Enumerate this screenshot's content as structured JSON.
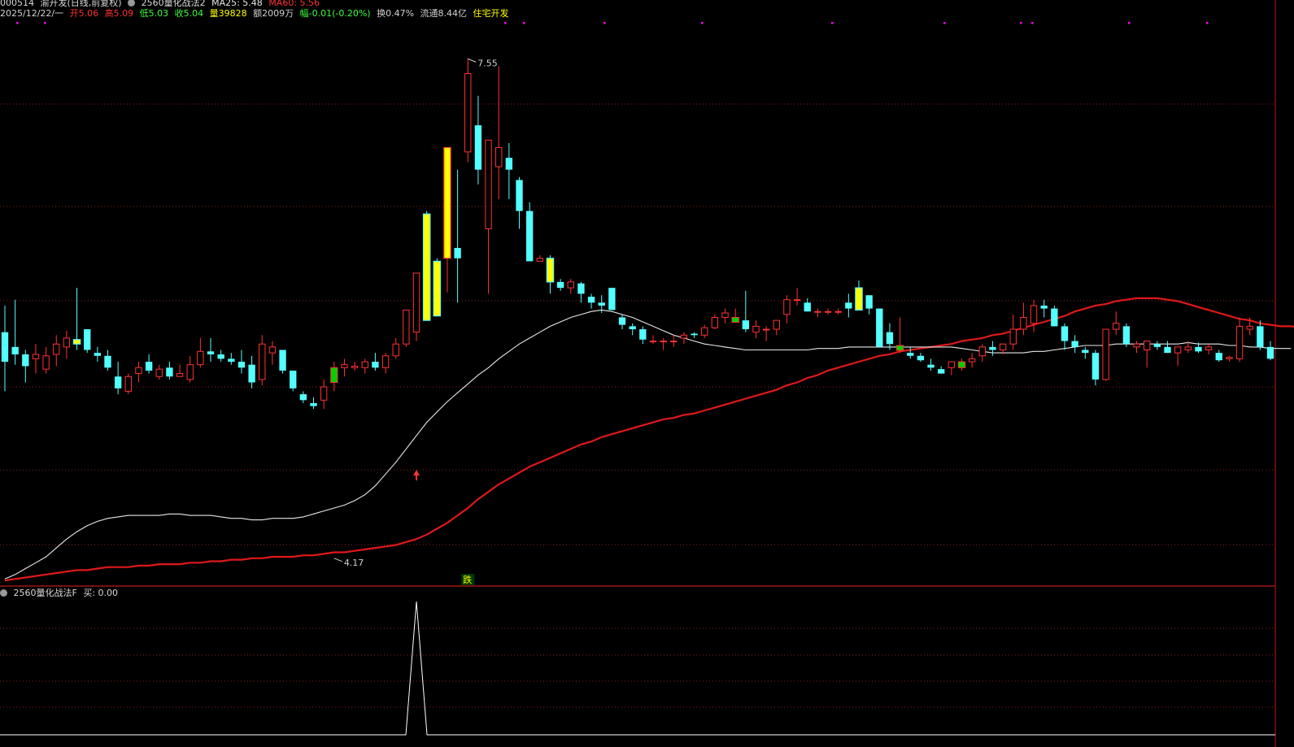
{
  "header": {
    "code": "000514",
    "name": "渝开发(日线,前复权)",
    "indicator": "2560量化战法2",
    "ma25": "MA25: 5.48",
    "ma60": "MA60: 5.56",
    "date": "2025/12/22/一",
    "open": "开5.06",
    "high": "高5.09",
    "low": "低5.03",
    "close": "收5.04",
    "volume": "量39828",
    "amount": "额2009万",
    "change": "幅-0.01(-0.20%)",
    "turnover": "换0.47%",
    "float_cap": "流通8.44亿",
    "sector": "住宅开发"
  },
  "sub": {
    "indicator": "2560量化战法F",
    "buy": "买: 0.00"
  },
  "colors": {
    "up": "#ff3232",
    "down": "#54ffff",
    "ma25": "#e8e8e8",
    "ma60": "#e01818",
    "grid": "#8a1e1e",
    "signal": "#ffff00",
    "marker": "#ff00ff",
    "green_box": "#00d000"
  },
  "chart_data": [
    {
      "type": "candlestick",
      "title": "",
      "y_annotations": [
        {
          "label": "7.55",
          "value": 7.55,
          "kind": "high"
        },
        {
          "label": "4.17",
          "value": 4.17,
          "kind": "low"
        }
      ],
      "signal_label": "跌",
      "ylim": [
        4.07,
        7.75
      ],
      "candles": [
        [
          5.7,
          5.88,
          5.3,
          5.5
        ],
        [
          5.6,
          5.92,
          5.48,
          5.55
        ],
        [
          5.55,
          5.58,
          5.36,
          5.47
        ],
        [
          5.52,
          5.62,
          5.42,
          5.55
        ],
        [
          5.45,
          5.6,
          5.42,
          5.54
        ],
        [
          5.55,
          5.68,
          5.47,
          5.62
        ],
        [
          5.6,
          5.71,
          5.52,
          5.66
        ],
        [
          5.65,
          6.0,
          5.58,
          5.62
        ],
        [
          5.72,
          5.72,
          5.56,
          5.58
        ],
        [
          5.56,
          5.6,
          5.5,
          5.54
        ],
        [
          5.54,
          5.58,
          5.44,
          5.46
        ],
        [
          5.4,
          5.5,
          5.28,
          5.32
        ],
        [
          5.3,
          5.42,
          5.28,
          5.4
        ],
        [
          5.42,
          5.5,
          5.36,
          5.46
        ],
        [
          5.5,
          5.55,
          5.42,
          5.44
        ],
        [
          5.4,
          5.48,
          5.38,
          5.45
        ],
        [
          5.46,
          5.5,
          5.38,
          5.4
        ],
        [
          5.4,
          5.48,
          5.4,
          5.42
        ],
        [
          5.38,
          5.54,
          5.36,
          5.48
        ],
        [
          5.48,
          5.66,
          5.46,
          5.57
        ],
        [
          5.57,
          5.66,
          5.5,
          5.55
        ],
        [
          5.55,
          5.58,
          5.5,
          5.52
        ],
        [
          5.52,
          5.56,
          5.48,
          5.5
        ],
        [
          5.5,
          5.58,
          5.42,
          5.46
        ],
        [
          5.48,
          5.54,
          5.32,
          5.36
        ],
        [
          5.38,
          5.68,
          5.34,
          5.62
        ],
        [
          5.56,
          5.64,
          5.48,
          5.6
        ],
        [
          5.58,
          5.58,
          5.42,
          5.44
        ],
        [
          5.44,
          5.44,
          5.3,
          5.32
        ],
        [
          5.28,
          5.3,
          5.22,
          5.24
        ],
        [
          5.22,
          5.26,
          5.18,
          5.2
        ],
        [
          5.24,
          5.38,
          5.18,
          5.33
        ],
        [
          5.36,
          5.5,
          5.3,
          5.46
        ],
        [
          5.46,
          5.52,
          5.4,
          5.48
        ],
        [
          5.46,
          5.5,
          5.44,
          5.47
        ],
        [
          5.46,
          5.52,
          5.42,
          5.5
        ],
        [
          5.5,
          5.56,
          5.44,
          5.46
        ],
        [
          5.46,
          5.56,
          5.42,
          5.54
        ],
        [
          5.54,
          5.66,
          5.52,
          5.62
        ],
        [
          5.62,
          5.85,
          5.6,
          5.85
        ],
        [
          5.7,
          6.1,
          5.64,
          6.1
        ],
        [
          6.5,
          6.52,
          5.78,
          5.78
        ],
        [
          6.18,
          6.2,
          5.81,
          5.81
        ],
        [
          6.2,
          6.95,
          5.97,
          6.95
        ],
        [
          6.27,
          6.8,
          5.9,
          6.2
        ],
        [
          6.92,
          7.55,
          6.85,
          7.45
        ],
        [
          7.1,
          7.3,
          6.7,
          6.8
        ],
        [
          6.4,
          7.0,
          5.96,
          7.0
        ],
        [
          6.82,
          7.5,
          6.6,
          6.95
        ],
        [
          6.88,
          6.98,
          6.6,
          6.8
        ],
        [
          6.73,
          6.75,
          6.4,
          6.52
        ],
        [
          6.52,
          6.58,
          6.18,
          6.18
        ],
        [
          6.18,
          6.22,
          6.18,
          6.2
        ],
        [
          6.2,
          6.22,
          5.96,
          6.04
        ],
        [
          6.04,
          6.06,
          5.98,
          6.0
        ],
        [
          6.0,
          6.06,
          5.96,
          6.04
        ],
        [
          6.03,
          6.04,
          5.9,
          5.96
        ],
        [
          5.94,
          5.96,
          5.86,
          5.9
        ],
        [
          5.9,
          5.95,
          5.83,
          5.88
        ],
        [
          6.0,
          6.0,
          5.85,
          5.85
        ],
        [
          5.8,
          5.82,
          5.72,
          5.75
        ],
        [
          5.74,
          5.76,
          5.68,
          5.72
        ],
        [
          5.72,
          5.74,
          5.62,
          5.65
        ],
        [
          5.64,
          5.68,
          5.62,
          5.64
        ],
        [
          5.64,
          5.66,
          5.58,
          5.64
        ],
        [
          5.64,
          5.68,
          5.6,
          5.64
        ],
        [
          5.66,
          5.7,
          5.62,
          5.68
        ],
        [
          5.69,
          5.7,
          5.66,
          5.68
        ],
        [
          5.68,
          5.75,
          5.66,
          5.73
        ],
        [
          5.73,
          5.82,
          5.72,
          5.8
        ],
        [
          5.8,
          5.86,
          5.76,
          5.83
        ],
        [
          5.8,
          5.86,
          5.78,
          5.8
        ],
        [
          5.78,
          5.98,
          5.7,
          5.72
        ],
        [
          5.7,
          5.78,
          5.66,
          5.74
        ],
        [
          5.72,
          5.74,
          5.64,
          5.72
        ],
        [
          5.72,
          5.74,
          5.68,
          5.78
        ],
        [
          5.82,
          5.95,
          5.76,
          5.92
        ],
        [
          5.92,
          6.0,
          5.88,
          5.92
        ],
        [
          5.9,
          5.93,
          5.84,
          5.84
        ],
        [
          5.84,
          5.86,
          5.8,
          5.84
        ],
        [
          5.84,
          5.86,
          5.82,
          5.84
        ],
        [
          5.84,
          5.86,
          5.82,
          5.84
        ],
        [
          5.9,
          5.96,
          5.8,
          5.86
        ],
        [
          6.0,
          6.05,
          5.85,
          5.85
        ],
        [
          5.95,
          5.95,
          5.82,
          5.86
        ],
        [
          5.86,
          5.86,
          5.6,
          5.6
        ],
        [
          5.7,
          5.76,
          5.58,
          5.62
        ],
        [
          5.6,
          5.8,
          5.56,
          5.61
        ],
        [
          5.56,
          5.6,
          5.52,
          5.54
        ],
        [
          5.54,
          5.56,
          5.5,
          5.51
        ],
        [
          5.48,
          5.52,
          5.44,
          5.46
        ],
        [
          5.45,
          5.47,
          5.42,
          5.42
        ],
        [
          5.46,
          5.5,
          5.41,
          5.5
        ],
        [
          5.46,
          5.52,
          5.44,
          5.5
        ],
        [
          5.5,
          5.56,
          5.46,
          5.52
        ],
        [
          5.54,
          5.62,
          5.5,
          5.6
        ],
        [
          5.6,
          5.64,
          5.54,
          5.58
        ],
        [
          5.58,
          5.62,
          5.55,
          5.62
        ],
        [
          5.62,
          5.82,
          5.58,
          5.72
        ],
        [
          5.72,
          5.9,
          5.68,
          5.8
        ],
        [
          5.76,
          5.92,
          5.7,
          5.88
        ],
        [
          5.88,
          5.92,
          5.8,
          5.86
        ],
        [
          5.86,
          5.88,
          5.74,
          5.74
        ],
        [
          5.74,
          5.76,
          5.58,
          5.64
        ],
        [
          5.64,
          5.68,
          5.56,
          5.6
        ],
        [
          5.58,
          5.6,
          5.52,
          5.56
        ],
        [
          5.56,
          5.58,
          5.34,
          5.38
        ],
        [
          5.38,
          5.7,
          5.37,
          5.72
        ],
        [
          5.72,
          5.84,
          5.68,
          5.76
        ],
        [
          5.74,
          5.76,
          5.6,
          5.62
        ],
        [
          5.6,
          5.64,
          5.56,
          5.62
        ],
        [
          5.58,
          5.64,
          5.46,
          5.64
        ],
        [
          5.62,
          5.64,
          5.58,
          5.6
        ],
        [
          5.6,
          5.64,
          5.56,
          5.56
        ],
        [
          5.56,
          5.6,
          5.47,
          5.6
        ],
        [
          5.58,
          5.64,
          5.56,
          5.6
        ],
        [
          5.6,
          5.63,
          5.56,
          5.57
        ],
        [
          5.58,
          5.62,
          5.55,
          5.6
        ],
        [
          5.56,
          5.58,
          5.5,
          5.51
        ],
        [
          5.52,
          5.54,
          5.5,
          5.53
        ],
        [
          5.52,
          5.8,
          5.5,
          5.74
        ],
        [
          5.72,
          5.8,
          5.68,
          5.74
        ],
        [
          5.74,
          5.78,
          5.58,
          5.6
        ],
        [
          5.6,
          5.64,
          5.51,
          5.52
        ]
      ],
      "ma25": [
        4.03,
        4.06,
        4.1,
        4.14,
        4.18,
        4.24,
        4.3,
        4.35,
        4.39,
        4.42,
        4.44,
        4.45,
        4.46,
        4.46,
        4.46,
        4.46,
        4.47,
        4.47,
        4.46,
        4.46,
        4.46,
        4.45,
        4.44,
        4.44,
        4.43,
        4.43,
        4.44,
        4.44,
        4.44,
        4.45,
        4.47,
        4.49,
        4.51,
        4.53,
        4.56,
        4.6,
        4.66,
        4.74,
        4.82,
        4.91,
        5.0,
        5.09,
        5.16,
        5.23,
        5.29,
        5.35,
        5.41,
        5.46,
        5.52,
        5.57,
        5.62,
        5.66,
        5.7,
        5.74,
        5.77,
        5.8,
        5.82,
        5.84,
        5.85,
        5.84,
        5.82,
        5.8,
        5.77,
        5.74,
        5.71,
        5.68,
        5.66,
        5.64,
        5.62,
        5.61,
        5.6,
        5.59,
        5.58,
        5.58,
        5.58,
        5.58,
        5.58,
        5.58,
        5.58,
        5.59,
        5.59,
        5.59,
        5.6,
        5.6,
        5.6,
        5.6,
        5.6,
        5.6,
        5.6,
        5.6,
        5.6,
        5.6,
        5.6,
        5.59,
        5.58,
        5.57,
        5.56,
        5.56,
        5.56,
        5.56,
        5.57,
        5.57,
        5.58,
        5.59,
        5.6,
        5.61,
        5.61,
        5.61,
        5.62,
        5.62,
        5.62,
        5.62,
        5.62,
        5.62,
        5.62,
        5.63,
        5.62,
        5.62,
        5.62,
        5.61,
        5.61,
        5.6,
        5.6,
        5.59,
        5.59,
        5.59
      ],
      "ma60": [
        4.02,
        4.03,
        4.04,
        4.05,
        4.06,
        4.07,
        4.08,
        4.09,
        4.09,
        4.1,
        4.11,
        4.11,
        4.11,
        4.12,
        4.12,
        4.13,
        4.13,
        4.13,
        4.14,
        4.14,
        4.15,
        4.15,
        4.16,
        4.16,
        4.17,
        4.17,
        4.18,
        4.18,
        4.18,
        4.19,
        4.19,
        4.2,
        4.21,
        4.21,
        4.22,
        4.23,
        4.24,
        4.25,
        4.26,
        4.28,
        4.3,
        4.33,
        4.37,
        4.41,
        4.46,
        4.51,
        4.57,
        4.62,
        4.67,
        4.71,
        4.75,
        4.79,
        4.82,
        4.85,
        4.88,
        4.91,
        4.94,
        4.96,
        4.99,
        5.01,
        5.03,
        5.05,
        5.07,
        5.09,
        5.11,
        5.12,
        5.14,
        5.15,
        5.17,
        5.19,
        5.21,
        5.23,
        5.25,
        5.27,
        5.29,
        5.31,
        5.34,
        5.36,
        5.39,
        5.41,
        5.44,
        5.46,
        5.48,
        5.5,
        5.52,
        5.54,
        5.55,
        5.57,
        5.58,
        5.59,
        5.6,
        5.61,
        5.62,
        5.64,
        5.65,
        5.66,
        5.68,
        5.69,
        5.71,
        5.73,
        5.75,
        5.77,
        5.79,
        5.81,
        5.84,
        5.86,
        5.88,
        5.89,
        5.91,
        5.92,
        5.93,
        5.93,
        5.93,
        5.92,
        5.91,
        5.89,
        5.87,
        5.85,
        5.83,
        5.81,
        5.79,
        5.78,
        5.76,
        5.75,
        5.74,
        5.74,
        5.73,
        5.72
      ]
    },
    {
      "type": "line",
      "title": "",
      "series": [
        {
          "values": "buy-signal spike at the breakout bar (index 40), 0 elsewhere"
        }
      ],
      "spike_index": 40,
      "ylim": [
        0,
        1
      ]
    }
  ]
}
